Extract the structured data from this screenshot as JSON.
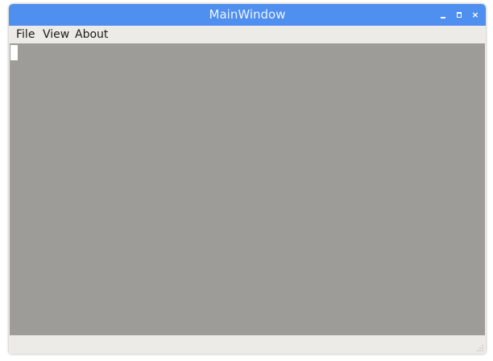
{
  "window": {
    "title": "MainWindow",
    "titlebar_color": "#4e8ff0",
    "content_background": "#9e9c98",
    "controls": {
      "minimize_icon": "minimize-icon",
      "maximize_icon": "maximize-icon",
      "close_icon": "close-icon",
      "close_glyph": "×"
    }
  },
  "menubar": {
    "items": [
      {
        "label": "File"
      },
      {
        "label": "View"
      },
      {
        "label": "About"
      }
    ]
  },
  "statusbar": {
    "text": ""
  }
}
